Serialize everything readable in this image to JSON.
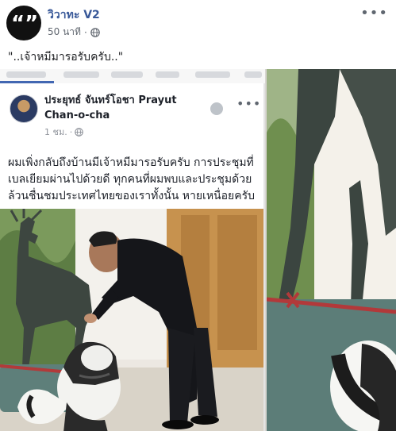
{
  "post": {
    "page_name": "วิวาทะ V2",
    "time": "50 นาที",
    "separator": "·",
    "text": "\"..เจ้าหมีมารอรับครับ..\""
  },
  "shared": {
    "author_name": "ประยุทธ์ จันทร์โอชา Prayut Chan-o-cha",
    "time": "1 ชม.",
    "separator": "·",
    "caption": "ผมเพิ่งกลับถึงบ้านมีเจ้าหมีมารอรับครับ การประชุมที่เบลเยียมผ่านไปด้วยดี ทุกคนที่ผมพบและประชุมด้วย ล้วนชื่นชมประเทศไทยของเราทั้งนั้น หายเหนื่อยครับ"
  },
  "icons": {
    "page_avatar": "quote-logo-icon",
    "globe": "globe-icon",
    "more": "more-dots-icon"
  },
  "colors": {
    "page_name": "#385898",
    "tab_active": "#4267b2",
    "meta": "#616770"
  }
}
